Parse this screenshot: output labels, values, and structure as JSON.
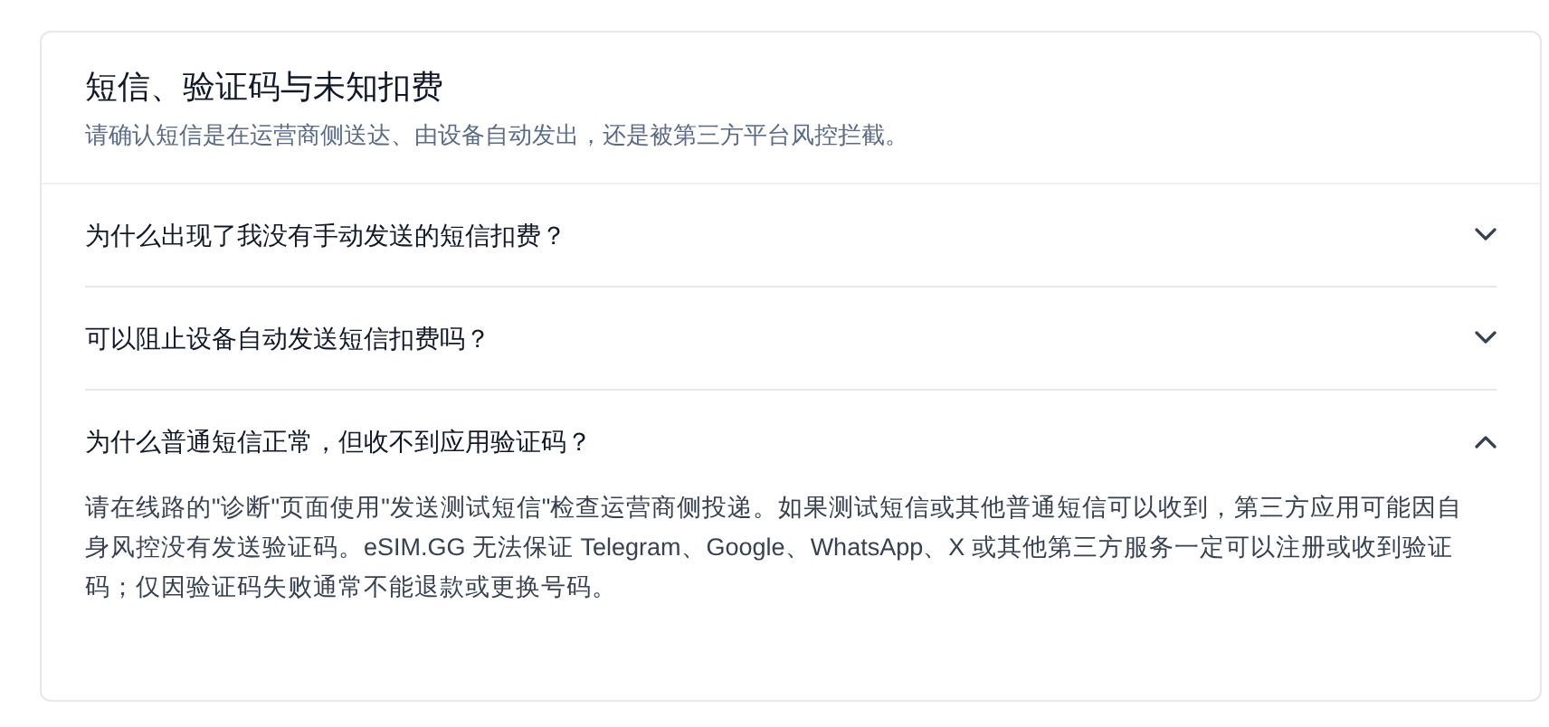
{
  "header": {
    "title": "短信、验证码与未知扣费",
    "subtitle": "请确认短信是在运营商侧送达、由设备自动发出，还是被第三方平台风控拦截。"
  },
  "faq": [
    {
      "question": "为什么出现了我没有手动发送的短信扣费？",
      "expanded": false
    },
    {
      "question": "可以阻止设备自动发送短信扣费吗？",
      "expanded": false
    },
    {
      "question": "为什么普通短信正常，但收不到应用验证码？",
      "expanded": true,
      "answer": "请在线路的\"诊断\"页面使用\"发送测试短信\"检查运营商侧投递。如果测试短信或其他普通短信可以收到，第三方应用可能因自身风控没有发送验证码。eSIM.GG 无法保证 Telegram、Google、WhatsApp、X 或其他第三方服务一定可以注册或收到验证码；仅因验证码失败通常不能退款或更换号码。"
    }
  ]
}
